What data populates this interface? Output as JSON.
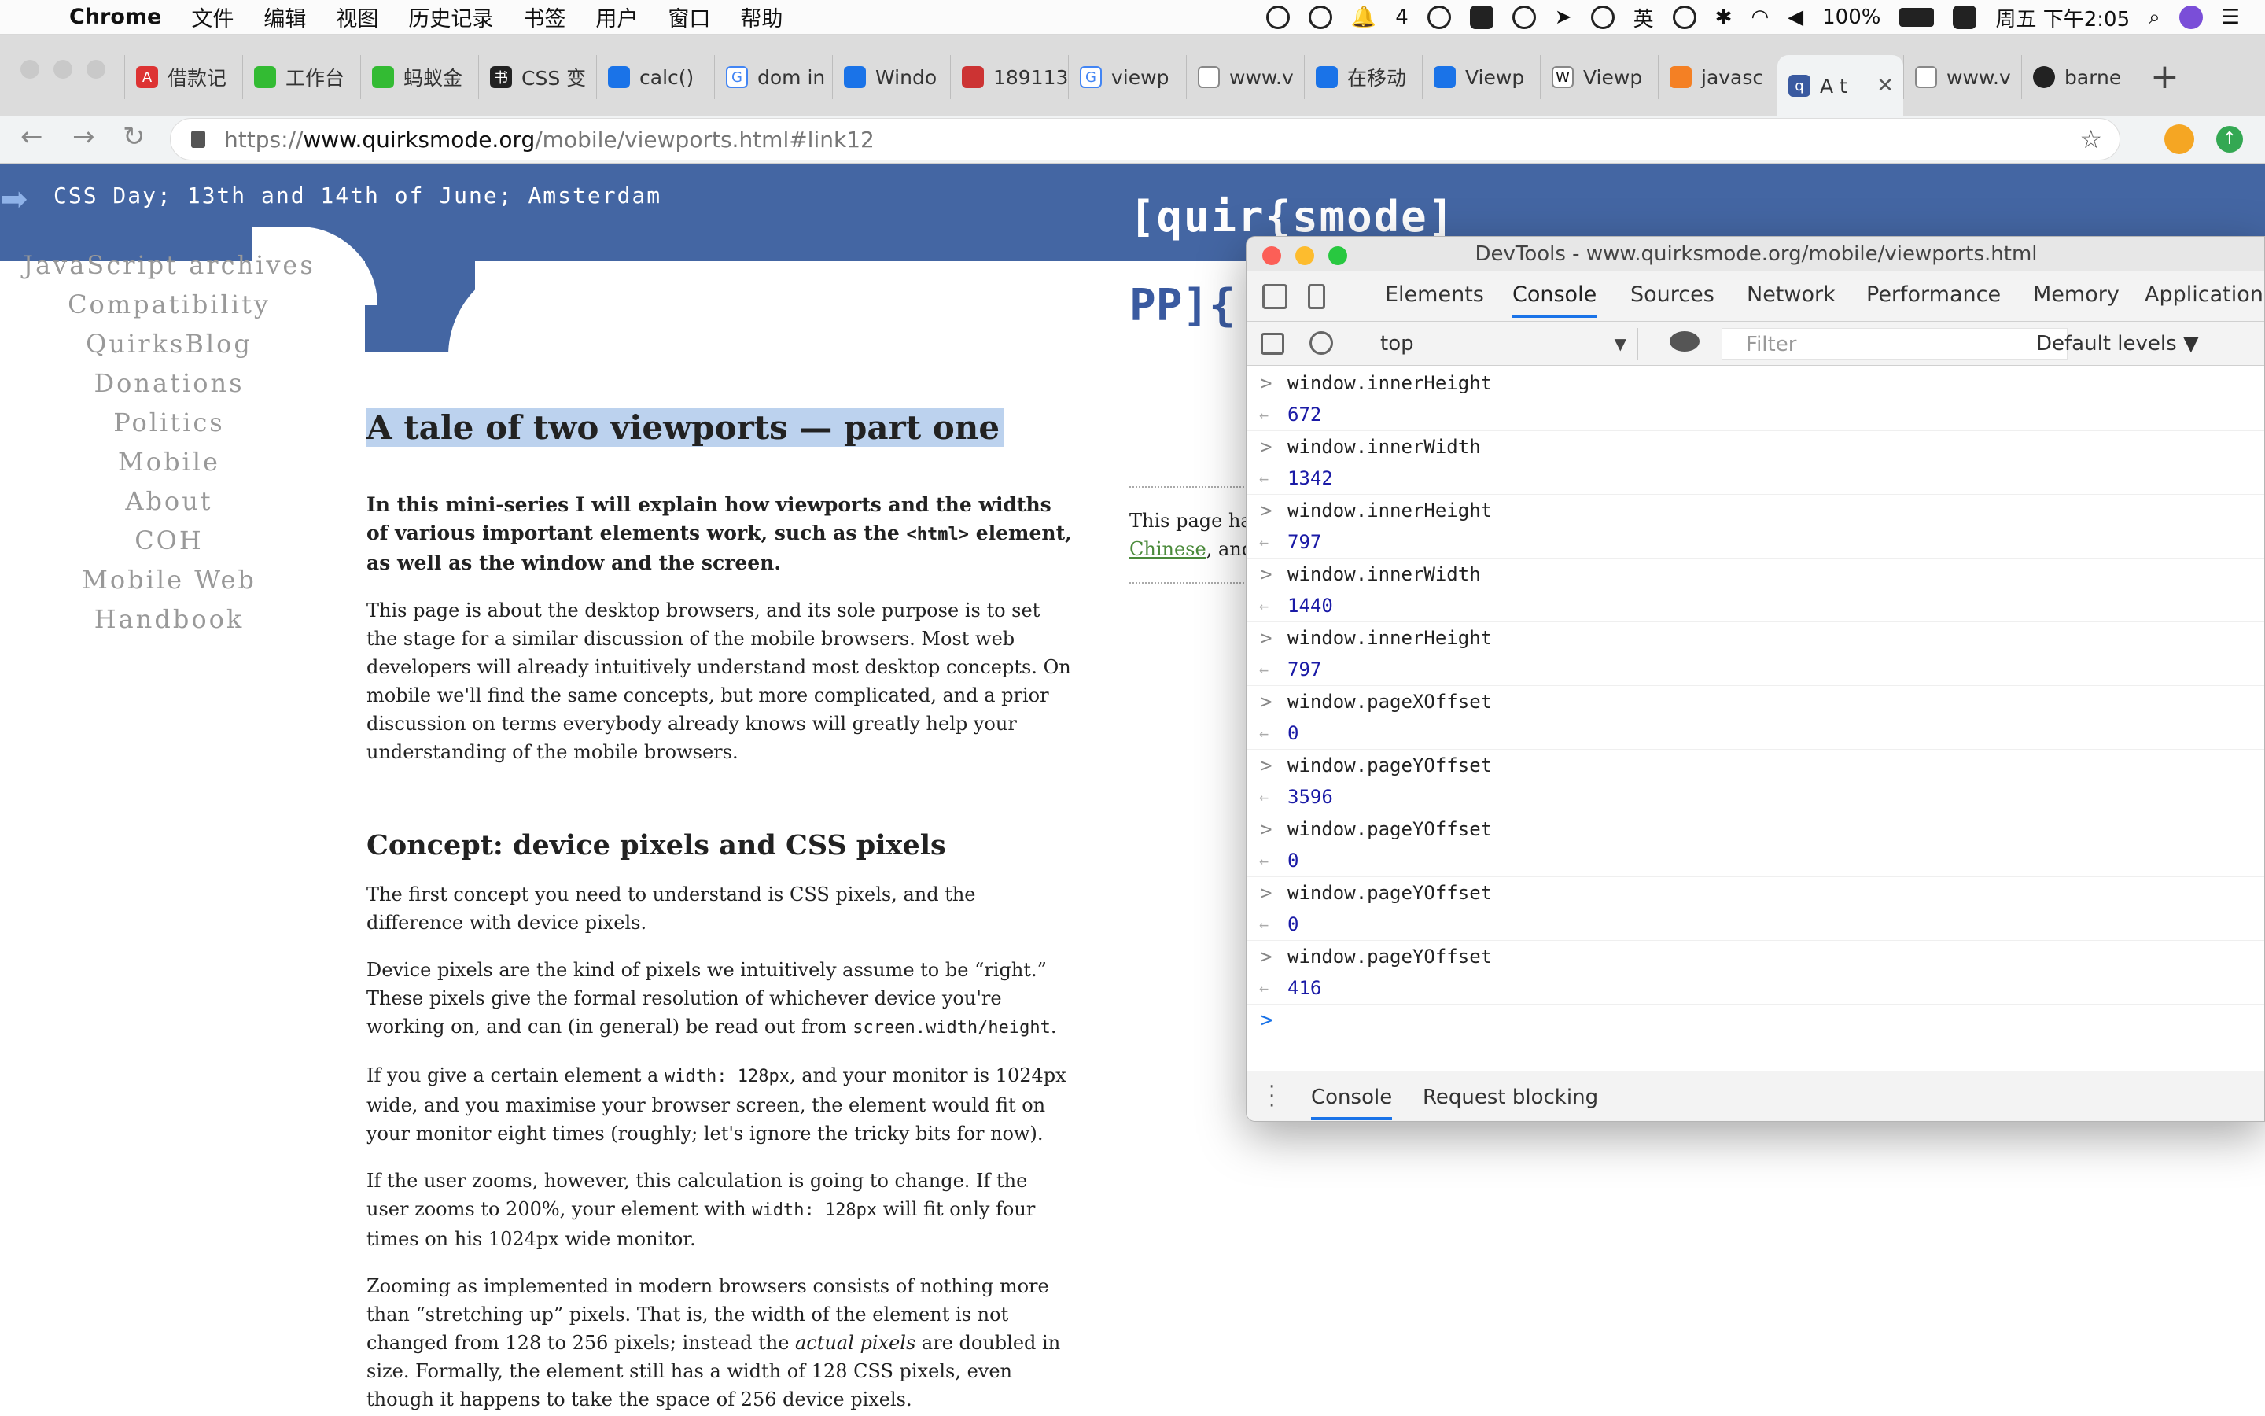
{
  "menubar": {
    "app": "Chrome",
    "items": [
      "文件",
      "编辑",
      "视图",
      "历史记录",
      "书签",
      "用户",
      "窗口",
      "帮助"
    ],
    "notification_count": "4",
    "input_method": "英",
    "battery": "100%",
    "clock": "周五 下午2:05"
  },
  "tabs": [
    {
      "title": "借款记"
    },
    {
      "title": "工作台"
    },
    {
      "title": "蚂蚁金"
    },
    {
      "title": "CSS 变"
    },
    {
      "title": "calc()"
    },
    {
      "title": "dom in"
    },
    {
      "title": "Windo"
    },
    {
      "title": "189113"
    },
    {
      "title": "viewp"
    },
    {
      "title": "www.v"
    },
    {
      "title": "在移动"
    },
    {
      "title": "Viewp"
    },
    {
      "title": "Viewp"
    },
    {
      "title": "javasc"
    },
    {
      "title": "A t"
    },
    {
      "title": "www.v"
    },
    {
      "title": "barne"
    }
  ],
  "address": {
    "scheme": "https://",
    "host": "www.quirksmode.org",
    "path": "/mobile/viewports.html#link12"
  },
  "site": {
    "announcement": "CSS Day; 13th and 14th of June; Amsterdam",
    "logo": "[quir{smode]",
    "logo2": "PP]{",
    "nav": [
      "JavaScript archives",
      "Compatibility",
      "QuirksBlog",
      "Donations",
      "Politics",
      "Mobile",
      "About",
      "COH",
      "Mobile Web",
      "Handbook"
    ]
  },
  "article": {
    "title": "A tale of two viewports — part one",
    "lead_1": "In this mini-series I will explain how viewports and the widths of various important elements work, such as the ",
    "lead_code": "<html>",
    "lead_2": " element, as well as the window and the screen.",
    "p1": "This page is about the desktop browsers, and its sole purpose is to set the stage for a similar discussion of the mobile browsers. Most web developers will already intuitively understand most desktop concepts. On mobile we'll find the same concepts, but more complicated, and a prior discussion on terms everybody already knows will greatly help your understanding of the mobile browsers.",
    "h2": "Concept: device pixels and CSS pixels",
    "p2": "The first concept you need to understand is CSS pixels, and the difference with device pixels.",
    "p3_1": "Device pixels are the kind of pixels we intuitively assume to be “right.” These pixels give the formal resolution of whichever device you're working on, and can (in general) be read out from ",
    "p3_code": "screen.width/height",
    "p3_2": ".",
    "p4_1": "If you give a certain element a ",
    "p4_code": "width: 128px",
    "p4_2": ", and your monitor is 1024px wide, and you maximise your browser screen, the element would fit on your monitor eight times (roughly; let's ignore the tricky bits for now).",
    "p5_1": "If the user zooms, however, this calculation is going to change. If the user zooms to 200%, your element with ",
    "p5_code": "width: 128px",
    "p5_2": " will fit only four times on his 1024px wide monitor.",
    "p6_1": "Zooming as implemented in modern browsers consists of nothing more than “stretching up” pixels. That is, the width of the element is not changed from 128 to 256 pixels; instead the ",
    "p6_em": "actual pixels",
    "p6_2": " are doubled in size. Formally, the element still has a width of 128 CSS pixels, even though it happens to take the space of 256 device pixels."
  },
  "right_note": {
    "text": "This page ha",
    "link": "Chinese",
    "after": ", and"
  },
  "devtools": {
    "title": "DevTools - www.quirksmode.org/mobile/viewports.html",
    "tabs": [
      "Elements",
      "Console",
      "Sources",
      "Network",
      "Performance",
      "Memory",
      "Application"
    ],
    "context": "top",
    "filter_placeholder": "Filter",
    "levels": "Default levels",
    "entries": [
      {
        "input": "window.innerHeight",
        "output": "672"
      },
      {
        "input": "window.innerWidth",
        "output": "1342"
      },
      {
        "input": "window.innerHeight",
        "output": "797"
      },
      {
        "input": "window.innerWidth",
        "output": "1440"
      },
      {
        "input": "window.innerHeight",
        "output": "797"
      },
      {
        "input": "window.pageXOffset",
        "output": "0"
      },
      {
        "input": "window.pageYOffset",
        "output": "3596"
      },
      {
        "input": "window.pageYOffset",
        "output": "0"
      },
      {
        "input": "window.pageYOffset",
        "output": "0"
      },
      {
        "input": "window.pageYOffset",
        "output": "416"
      }
    ],
    "prompt": ">",
    "drawer_tabs": [
      "Console",
      "Request blocking"
    ]
  }
}
